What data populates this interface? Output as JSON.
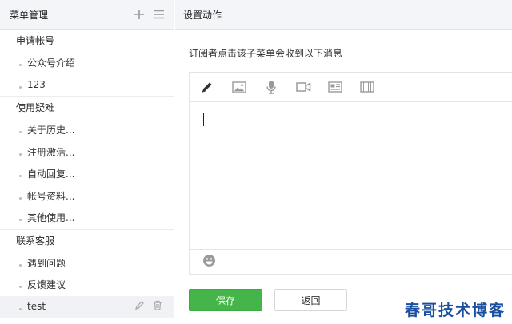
{
  "left_panel": {
    "title": "菜单管理",
    "add_icon": "plus-icon",
    "sort_icon": "menu-lines-icon"
  },
  "menu_groups": [
    {
      "label": "申请帐号",
      "items": [
        "公众号介绍",
        "123"
      ]
    },
    {
      "label": "使用疑难",
      "items": [
        "关于历史...",
        "注册激活...",
        "自动回复...",
        "帐号资料...",
        "其他使用..."
      ]
    },
    {
      "label": "联系客服",
      "items": [
        "遇到问题",
        "反馈建议",
        "test"
      ]
    }
  ],
  "active_item": {
    "label": "test",
    "edit_icon": "pencil-icon",
    "delete_icon": "trash-icon"
  },
  "right_panel": {
    "title": "设置动作",
    "description": "订阅者点击该子菜单会收到以下消息"
  },
  "editor": {
    "toolbar": [
      "pencil-icon",
      "image-icon",
      "microphone-icon",
      "video-icon",
      "news-card-icon",
      "film-strip-icon"
    ],
    "active_tool": "pencil-icon",
    "content": "",
    "emoji_icon": "emoji-icon"
  },
  "buttons": {
    "save": "保存",
    "back": "返回"
  },
  "watermark": "春哥技术博客",
  "colors": {
    "primary_green": "#44b549",
    "header_bg": "#f4f5f9",
    "border": "#e4e4e4"
  }
}
